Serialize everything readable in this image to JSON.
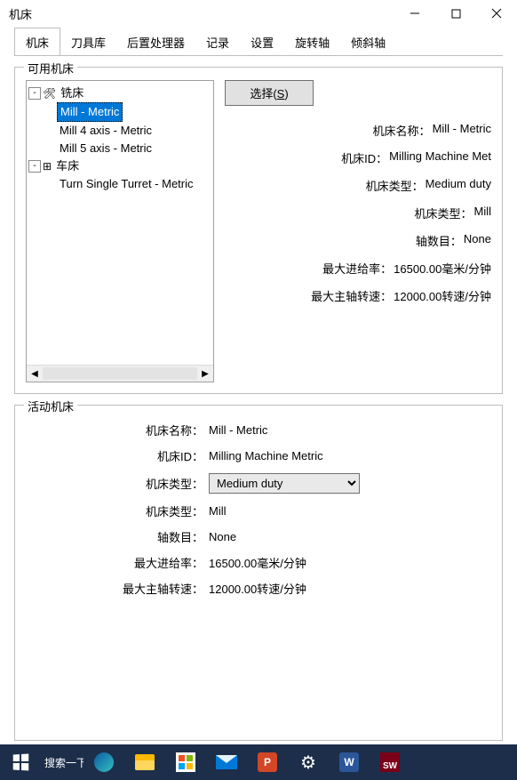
{
  "window_title": "机床",
  "tabs": [
    "机床",
    "刀具库",
    "后置处理器",
    "记录",
    "设置",
    "旋转轴",
    "倾斜轴"
  ],
  "available_group": "可用机床",
  "tree": {
    "mill_group": "铣床",
    "mill_items": [
      "Mill - Metric",
      "Mill 4 axis - Metric",
      "Mill 5 axis - Metric"
    ],
    "lathe_group": "车床",
    "lathe_items": [
      "Turn Single Turret - Metric"
    ]
  },
  "select_btn_prefix": "选择(",
  "select_btn_key": "S",
  "select_btn_suffix": ")",
  "info_labels": {
    "name": "机床名称：",
    "id": "机床ID：",
    "type": "机床类型：",
    "kind": "机床类型：",
    "axes": "轴数目：",
    "feed": "最大进给率：",
    "spindle": "最大主轴转速："
  },
  "info_values": {
    "name": "Mill - Metric",
    "id": "Milling Machine Met",
    "type": "Medium duty",
    "kind": "Mill",
    "axes": "None",
    "feed": "16500.00毫米/分钟",
    "spindle": "12000.00转速/分钟"
  },
  "active_group": "活动机床",
  "active": {
    "name": "Mill - Metric",
    "id": "Milling Machine Metric",
    "type": "Medium duty",
    "kind": "Mill",
    "axes": "None",
    "feed": "16500.00毫米/分钟",
    "spindle": "12000.00转速/分钟"
  },
  "taskbar": {
    "search": "搜索一下",
    "ppt": "P",
    "word": "W",
    "sw": "SW"
  }
}
